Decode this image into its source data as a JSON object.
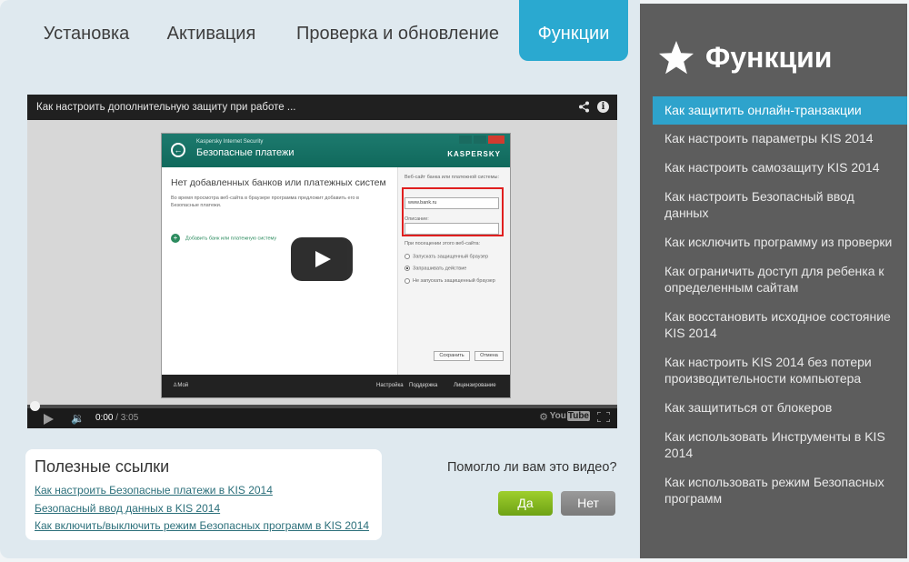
{
  "tabs": [
    {
      "label": "Установка"
    },
    {
      "label": "Активация"
    },
    {
      "label": "Проверка и обновление"
    },
    {
      "label": "Функции"
    }
  ],
  "video": {
    "title": "Как настроить дополнительную защиту при работе ...",
    "current_time": "0:00",
    "duration": "/ 3:05",
    "youtube_label": "You",
    "youtube_tube": "Tube",
    "app": {
      "subtitle": "Kaspersky Internet Security",
      "title": "Безопасные платежи",
      "brand": "KASPERSKY",
      "heading": "Нет добавленных банков или платежных систем",
      "desc": "Во время просмотра веб-сайта в браузере программа предложит добавить его в Безопасные платежи.",
      "add_link": "Добавить банк или платежную систему",
      "site_label": "Веб-сайт банка или платежной системы:",
      "site_value": "www.bank.ru",
      "desc_label": "Описание:",
      "visit_label": "При посещении этого веб-сайта:",
      "radio_1": "Запускать защищенный браузер",
      "radio_2": "Запрашивать действие",
      "radio_3": "Не запускать защищенный браузер",
      "save": "Сохранить",
      "cancel": "Отмена",
      "profile": "Мой профиль",
      "settings": "Настройка",
      "support": "Поддержка",
      "licensing": "Лицензирование"
    }
  },
  "links": {
    "title": "Полезные ссылки",
    "items": [
      "Как настроить Безопасные платежи в KIS 2014",
      "Безопасный ввод данных в KIS 2014",
      "Как включить/выключить режим Безопасных программ в KIS 2014"
    ]
  },
  "feedback": {
    "question": "Помогло ли вам это видео?",
    "yes": "Да",
    "no": "Нет"
  },
  "sidebar": {
    "title": "Функции",
    "items": [
      "Как защитить онлайн-транзакции",
      "Как настроить параметры KIS 2014",
      "Как настроить самозащиту KIS 2014",
      "Как настроить Безопасный ввод данных",
      "Как исключить программу из проверки",
      "Как ограничить доступ для ребенка к определенным сайтам",
      "Как восстановить исходное состояние KIS 2014",
      "Как настроить KIS 2014 без потери производительности компьютера",
      "Как защититься от блокеров",
      "Как использовать Инструменты в KIS 2014",
      "Как использовать режим Безопасных программ"
    ]
  },
  "colors": {
    "accent": "#2aa9d0",
    "sidebar_bg": "#5d5d5d",
    "yes": "#86bb1e",
    "no": "#8a8a8a"
  }
}
